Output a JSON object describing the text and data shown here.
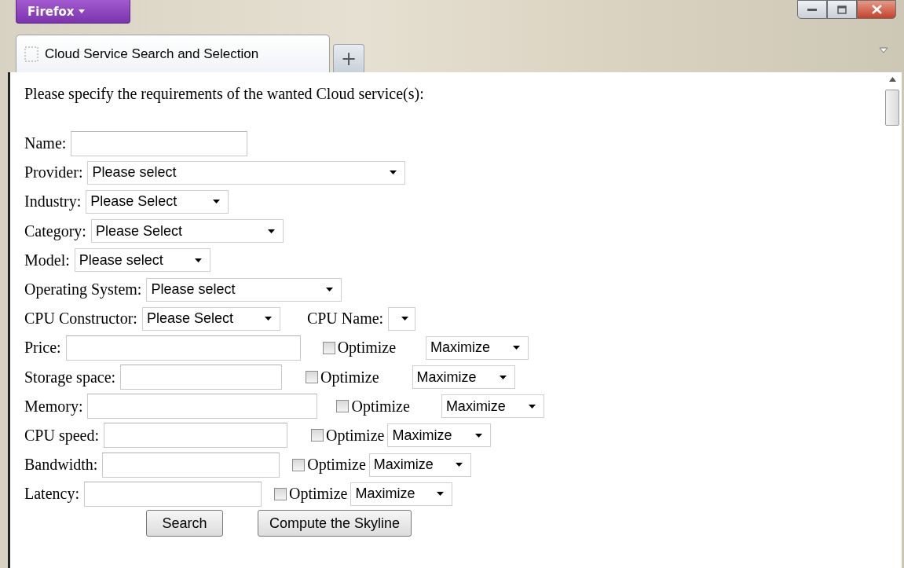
{
  "app_button": {
    "label": "Firefox"
  },
  "tabs": [
    {
      "label": "Cloud Service Search and Selection",
      "selected": true
    }
  ],
  "new_tab": {
    "label": "+"
  },
  "intro": "Please specify the requirements of the wanted Cloud service(s):",
  "rows": [
    {
      "kind": "text",
      "label": "Name:"
    },
    {
      "kind": "select",
      "label": "Provider:",
      "value": "Please select"
    },
    {
      "kind": "select",
      "label": "Industry:",
      "value": "Please Select"
    },
    {
      "kind": "select",
      "label": "Category:",
      "value": "Please Select"
    },
    {
      "kind": "select",
      "label": "Model:",
      "value": "Please select"
    },
    {
      "kind": "select",
      "label": "Operating System:",
      "value": "Please select"
    },
    {
      "kind": "select_pair",
      "label": "CPU Constructor:",
      "value": "Please Select",
      "second_label": "CPU Name:"
    },
    {
      "kind": "metric",
      "label": "Price:",
      "optimize": {
        "label": "Optimize",
        "checked": false
      },
      "direction": "Maximize"
    },
    {
      "kind": "metric",
      "label": "Storage space:",
      "optimize": {
        "label": "Optimize",
        "checked": false
      },
      "direction": "Maximize"
    },
    {
      "kind": "metric",
      "label": "Memory:",
      "optimize": {
        "label": "Optimize",
        "checked": false
      },
      "direction": "Maximize"
    },
    {
      "kind": "metric",
      "label": "CPU speed:",
      "optimize": {
        "label": "Optimize",
        "checked": false
      },
      "direction": "Maximize"
    },
    {
      "kind": "metric",
      "label": "Bandwidth:",
      "optimize": {
        "label": "Optimize",
        "checked": false
      },
      "direction": "Maximize"
    },
    {
      "kind": "metric",
      "label": "Latency:",
      "optimize": {
        "label": "Optimize",
        "checked": false
      },
      "direction": "Maximize"
    }
  ],
  "buttons": [
    "Search",
    "Compute the Skyline"
  ]
}
